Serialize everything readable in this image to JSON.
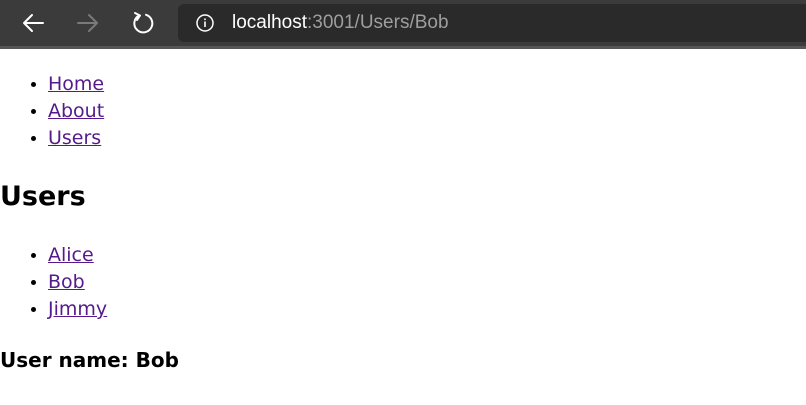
{
  "browser": {
    "url_host": "localhost",
    "url_path": ":3001/Users/Bob",
    "icons": {
      "back": "back-arrow-icon",
      "forward": "forward-arrow-icon",
      "reload": "reload-icon",
      "info": "info-icon"
    }
  },
  "nav": {
    "items": [
      {
        "label": "Home"
      },
      {
        "label": "About"
      },
      {
        "label": "Users"
      }
    ]
  },
  "users": {
    "heading": "Users",
    "items": [
      {
        "label": "Alice"
      },
      {
        "label": "Bob"
      },
      {
        "label": "Jimmy"
      }
    ]
  },
  "user_detail": {
    "text": "User name: Bob"
  },
  "colors": {
    "toolbar_bg": "#3b3b3b",
    "address_bg": "#2a2a2a",
    "link_visited": "#551a8b"
  }
}
